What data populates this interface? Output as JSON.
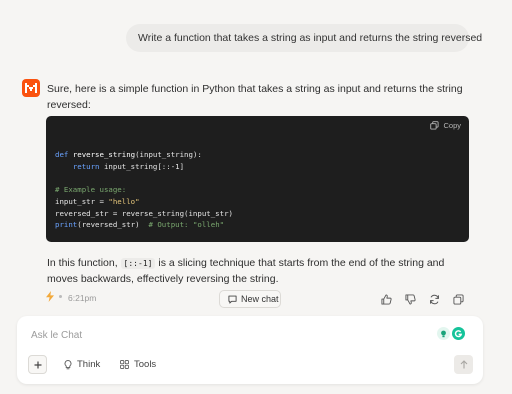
{
  "user_message": "Write a function that takes a string as input and returns the string reversed",
  "assistant": {
    "intro": "Sure, here is a simple function in Python that takes a string as input and returns the string reversed:",
    "code": {
      "copy_label": "Copy",
      "line1_kw": "def",
      "line1_fn": "reverse_string",
      "line1_rest": "(input_string):",
      "line2_kw": "return",
      "line2_rest": " input_string[::-1]",
      "line3_comment": "# Example usage:",
      "line4_pre": "input_str = ",
      "line4_str": "\"hello\"",
      "line5": "reversed_str = reverse_string(input_str)",
      "line6_kw": "print",
      "line6_rest": "(reversed_str)  ",
      "line6_comment": "# Output: \"olleh\""
    },
    "explanation_pre": "In this function, ",
    "explanation_code": "[::-1]",
    "explanation_post": " is a slicing technique that starts from the end of the string and moves backwards, effectively reversing the string.",
    "time": "6:21pm",
    "new_chat_label": "New chat"
  },
  "composer": {
    "placeholder": "Ask le Chat",
    "think_label": "Think",
    "tools_label": "Tools"
  },
  "colors": {
    "brand": "#fa520f",
    "code_bg": "#1e1e1e",
    "grammarly": "#15c39a"
  }
}
